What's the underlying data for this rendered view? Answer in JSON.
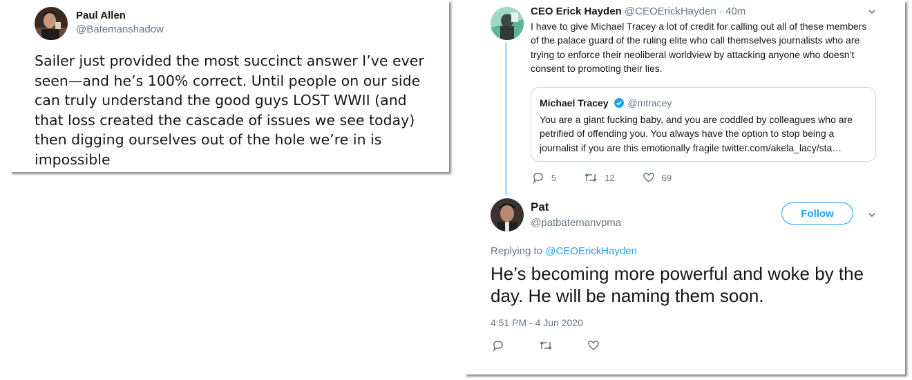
{
  "left_tweet": {
    "name": "Paul Allen",
    "handle": "@Batemanshadow",
    "text": "Sailer just provided the most succinct answer I’ve ever seen—and he’s 100% correct. Until people on our side can truly understand the good guys LOST WWII (and that loss created the cascade of issues we see today) then digging ourselves out of the hole we’re in is impossible"
  },
  "right_tweet": {
    "name": "CEO Erick Hayden",
    "handle": "@CEOErickHayden",
    "age": "· 40m",
    "text": "I have to give Michael Tracey a lot of credit for calling out all of these members of the palace guard of the ruling elite who call themselves journalists who are trying to enforce their neoliberal worldview by attacking anyone who doesn’t consent to promoting their lies.",
    "quote": {
      "name": "Michael Tracey",
      "handle": "@mtracey",
      "text": "You are a giant fucking baby, and you are coddled by colleagues who are petrified of offending you. You always have the option to stop being a journalist if you are this emotionally fragile twitter.com/akela_lacy/sta…"
    },
    "actions": {
      "replies": "5",
      "retweets": "12",
      "likes": "69"
    }
  },
  "reply": {
    "name": "Pat",
    "handle": "@patbatemanvpma",
    "follow_label": "Follow",
    "replying_prefix": "Replying to",
    "replying_to": "@CEOErickHayden",
    "text": "He’s becoming more powerful and woke by the day. He will be naming them soon.",
    "timestamp": "4:51 PM - 4 Jun 2020"
  },
  "colors": {
    "accent": "#1da1f2",
    "muted": "#657786",
    "thread": "#b3def7",
    "border": "#ccd6dd"
  }
}
